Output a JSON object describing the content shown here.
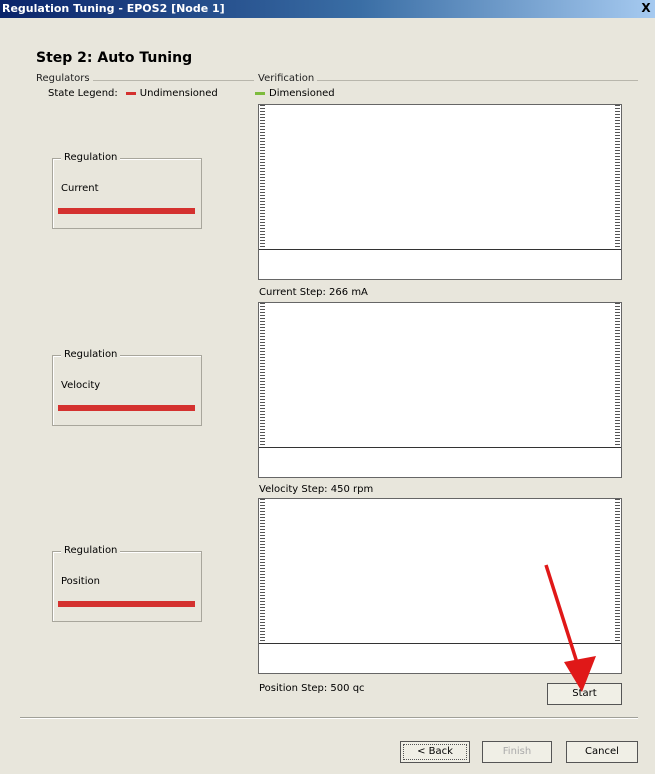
{
  "window": {
    "title": "Regulation Tuning - EPOS2 [Node 1]",
    "close_glyph": "X"
  },
  "step_title": "Step 2: Auto Tuning",
  "groups": {
    "regulators": "Regulators",
    "verification": "Verification"
  },
  "legend": {
    "label": "State Legend:",
    "undimensioned": "Undimensioned",
    "dimensioned": "Dimensioned",
    "undimensioned_color": "#d4312f",
    "dimensioned_color": "#7dbb3d"
  },
  "regulators": [
    {
      "caption": "Regulation",
      "name": "Current",
      "state": "undimensioned"
    },
    {
      "caption": "Regulation",
      "name": "Velocity",
      "state": "undimensioned"
    },
    {
      "caption": "Regulation",
      "name": "Position",
      "state": "undimensioned"
    }
  ],
  "steps": {
    "current": "Current Step: 266 mA",
    "velocity": "Velocity Step: 450 rpm",
    "position": "Position Step: 500 qc"
  },
  "buttons": {
    "start": "Start",
    "back": "< Back",
    "finish": "Finish",
    "cancel": "Cancel"
  },
  "annotation": {
    "arrow_color": "#e01818"
  }
}
